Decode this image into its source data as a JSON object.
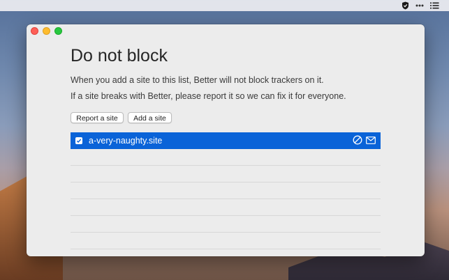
{
  "menubar": {
    "icons": [
      "shield-check-icon",
      "more-dots-icon",
      "list-icon"
    ]
  },
  "window": {
    "title": "Do not block",
    "description_1": "When you add a site to this list, Better will not block trackers on it.",
    "description_2": "If a site breaks with Better, please report it so we can fix it for everyone.",
    "buttons": {
      "report_label": "Report a site",
      "add_label": "Add a site"
    },
    "sites": [
      {
        "name": "a-very-naughty.site",
        "checked": true,
        "selected": true
      }
    ],
    "empty_row_count": 6
  },
  "colors": {
    "selection": "#0a63d8",
    "window_bg": "#ececec",
    "close": "#fe5f57",
    "minimize": "#febc2e",
    "maximize": "#28c840"
  }
}
